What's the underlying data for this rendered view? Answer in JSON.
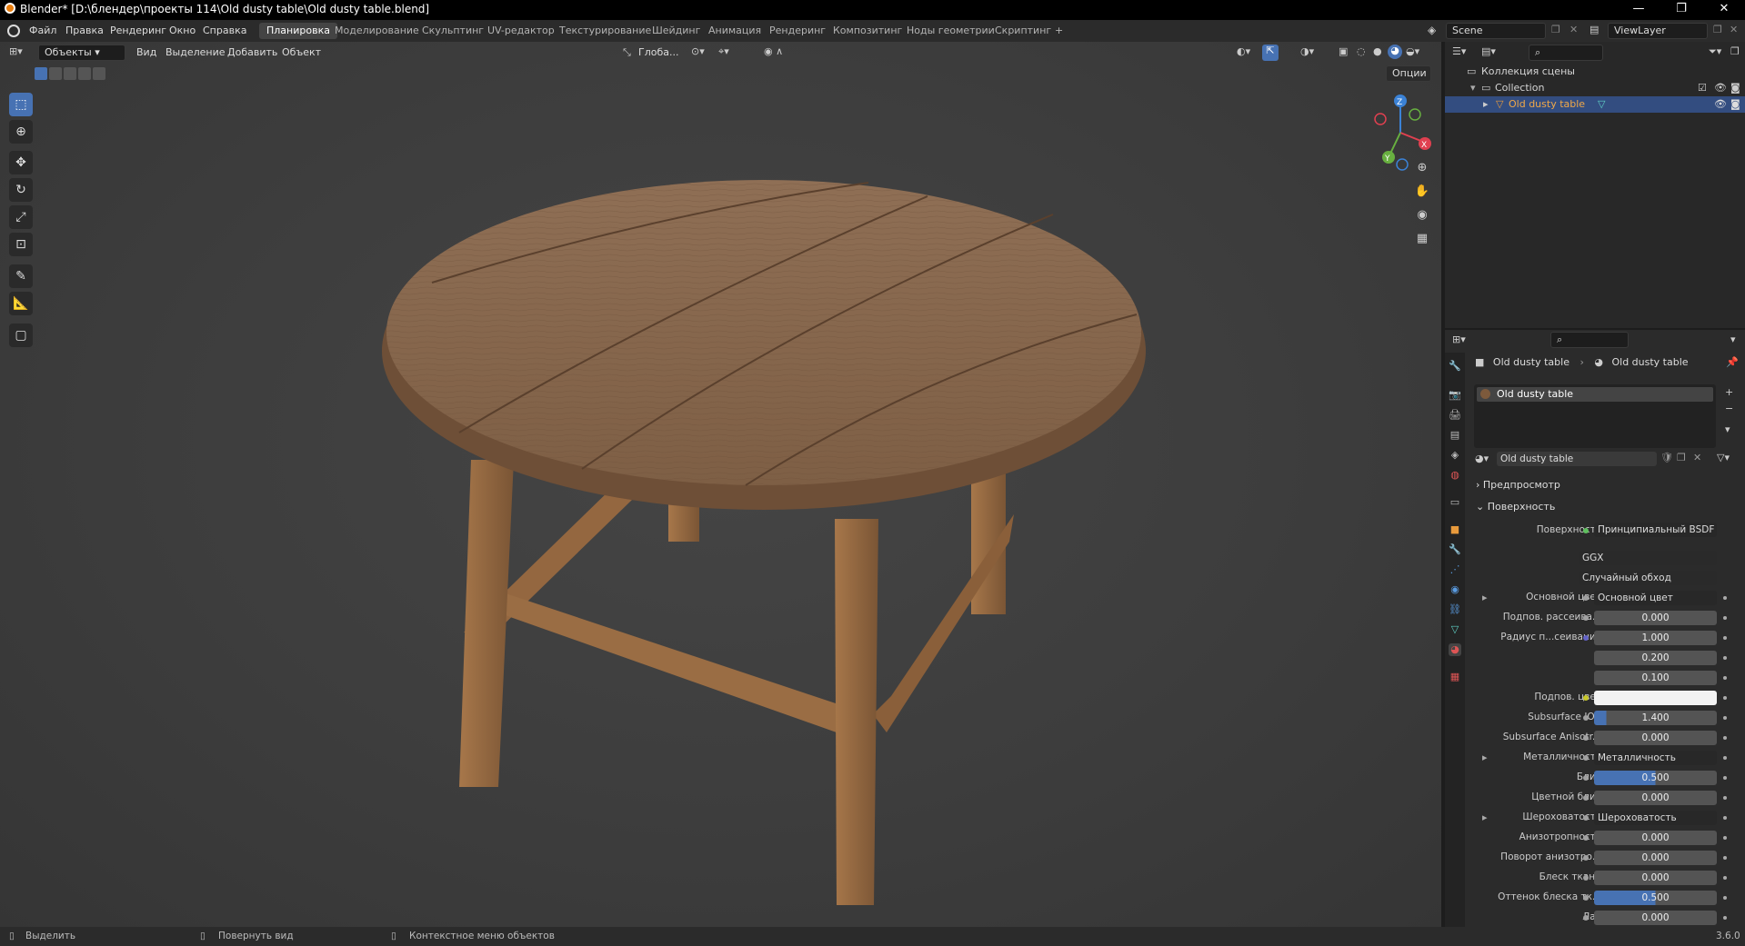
{
  "window": {
    "title": "Blender* [D:\\блендер\\проекты 114\\Old dusty table\\Old dusty table.blend]",
    "minimize": "—",
    "maximize": "❐",
    "close": "✕"
  },
  "topbar": {
    "menus": [
      "Файл",
      "Правка",
      "Рендеринг",
      "Окно",
      "Справка"
    ],
    "workspaces": [
      "Планировка",
      "Моделирование",
      "Скульптинг",
      "UV-редактор",
      "Текстурирование",
      "Шейдинг",
      "Анимация",
      "Рендеринг",
      "Композитинг",
      "Ноды геометрии",
      "Скриптинг"
    ],
    "add_tab": "+",
    "active_workspace_index": 0,
    "scene": "Scene",
    "view_layer": "ViewLayer"
  },
  "viewport": {
    "mode": "Объекты",
    "menus": [
      "Вид",
      "Выделение",
      "Добавить",
      "Объект"
    ],
    "orientation": "Глоба...",
    "options": "Опции",
    "gizmo_axes": {
      "x": "X",
      "y": "Y",
      "z": "Z"
    }
  },
  "outliner": {
    "items": [
      {
        "label": "Коллекция сцены",
        "level": 0
      },
      {
        "label": "Collection",
        "level": 1
      },
      {
        "label": "Old dusty table",
        "level": 2,
        "selected": true
      }
    ]
  },
  "properties": {
    "breadcrumb_object": "Old dusty table",
    "breadcrumb_material": "Old dusty table",
    "material_slot": "Old dusty table",
    "material_name": "Old dusty table",
    "panel_preview": "Предпросмотр",
    "panel_surface": "Поверхность",
    "surface_label": "Поверхность",
    "surface_value": "Принципиальный BSDF",
    "distribution": "GGX",
    "subsurface_method": "Случайный обход",
    "rows": [
      {
        "label": "Основной цвет",
        "value": "Основной цвет",
        "kind": "link",
        "expand": true
      },
      {
        "label": "Подпов. рассеива...",
        "value": "0.000",
        "kind": "num"
      },
      {
        "label": "Радиус п...сеивания",
        "value": "1.000",
        "kind": "num"
      },
      {
        "label": "",
        "value": "0.200",
        "kind": "num"
      },
      {
        "label": "",
        "value": "0.100",
        "kind": "num"
      },
      {
        "label": "Подпов. цвет",
        "value": "",
        "kind": "color"
      },
      {
        "label": "Subsurface IOR",
        "value": "1.400",
        "kind": "num",
        "fill": 0.1
      },
      {
        "label": "Subsurface Anisotr...",
        "value": "0.000",
        "kind": "num"
      },
      {
        "label": "Металличность",
        "value": "Металличность",
        "kind": "link",
        "expand": true
      },
      {
        "label": "Блик",
        "value": "0.500",
        "kind": "num",
        "fill": 0.5
      },
      {
        "label": "Цветной блик",
        "value": "0.000",
        "kind": "num"
      },
      {
        "label": "Шероховатость",
        "value": "Шероховатость",
        "kind": "link",
        "expand": true
      },
      {
        "label": "Анизотропность",
        "value": "0.000",
        "kind": "num"
      },
      {
        "label": "Поворот анизотро...",
        "value": "0.000",
        "kind": "num"
      },
      {
        "label": "Блеск ткани",
        "value": "0.000",
        "kind": "num"
      },
      {
        "label": "Оттенок блеска тк...",
        "value": "0.500",
        "kind": "num",
        "fill": 0.5
      },
      {
        "label": "Лак",
        "value": "0.000",
        "kind": "num"
      }
    ]
  },
  "statusbar": {
    "select": "Выделить",
    "rotate": "Повернуть вид",
    "context": "Контекстное меню объектов",
    "version": "3.6.0"
  },
  "colors": {
    "accent": "#4772b3",
    "selected_row": "#334d80",
    "wood": "#8a6a4f"
  }
}
